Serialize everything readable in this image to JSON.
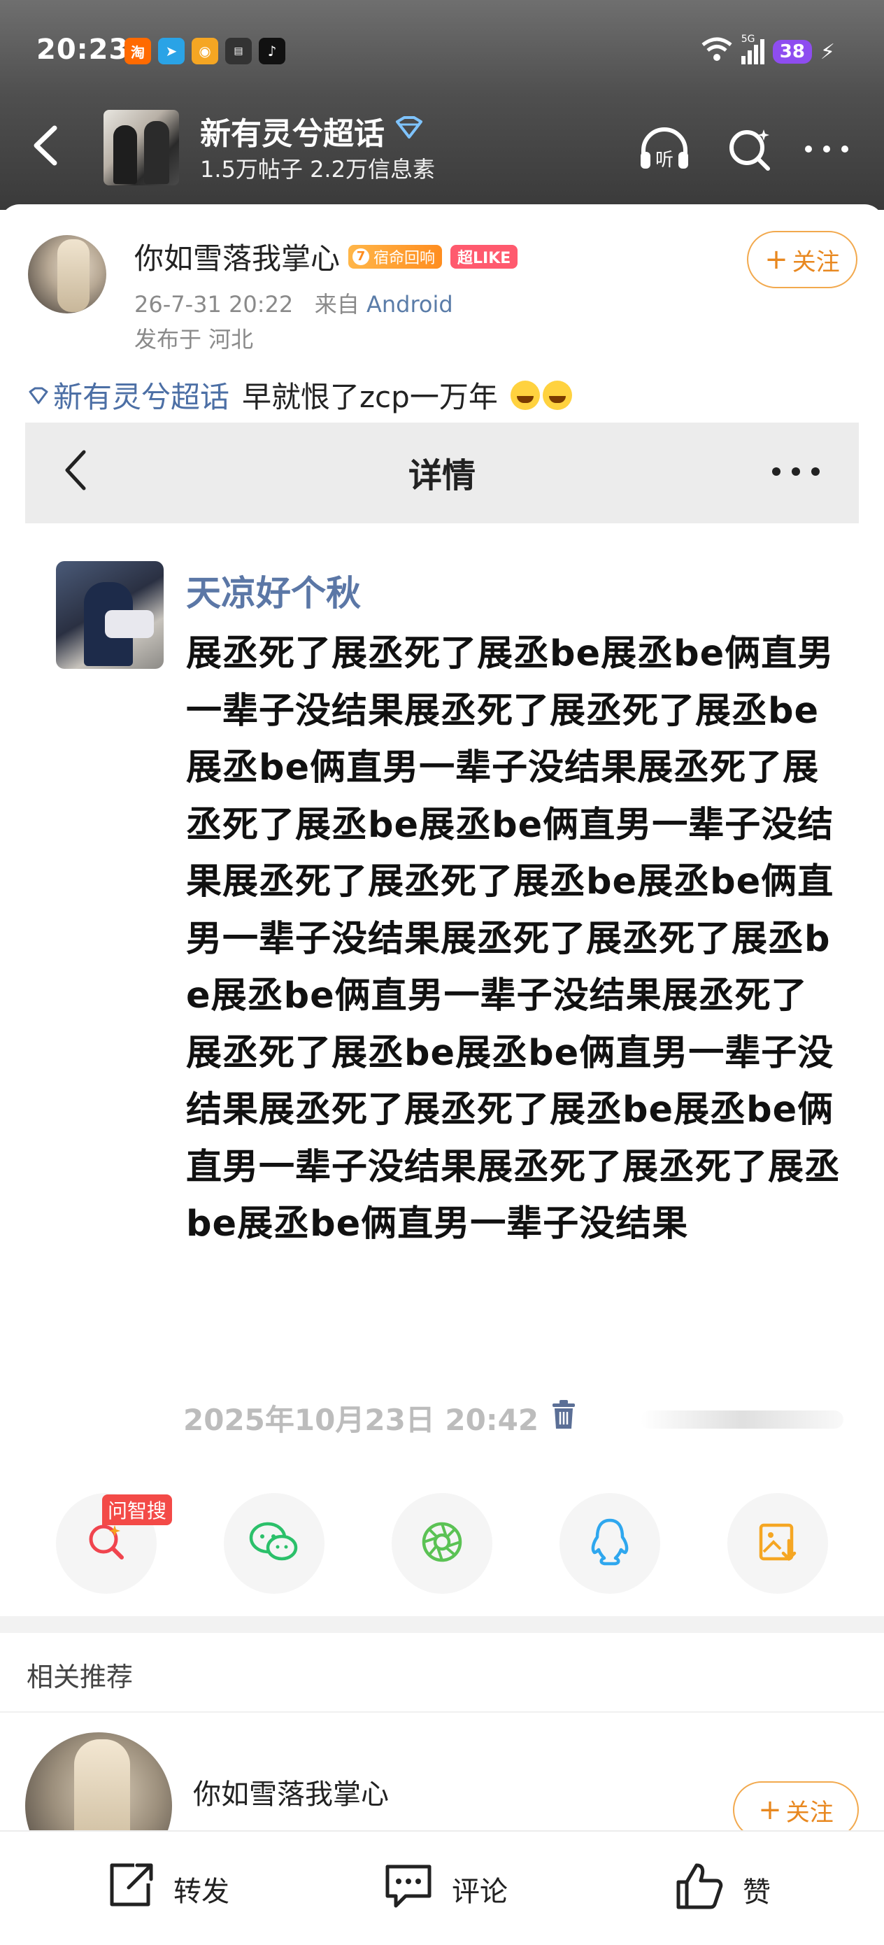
{
  "status_bar": {
    "time": "20:23",
    "network": "5G",
    "battery": "38",
    "app_icons": [
      "taobao-icon",
      "telegram-icon",
      "weibo-icon",
      "notes-icon",
      "tiktok-icon"
    ]
  },
  "header": {
    "title": "新有灵兮超话",
    "stats": "1.5万帖子 2.2万信息素",
    "icons": [
      "back-icon",
      "listen-icon",
      "search-icon",
      "more-icon"
    ]
  },
  "post": {
    "author": "你如雪落我掌心",
    "badge_level": "7",
    "badge_text": "宿命回响",
    "badge_like": "超LIKE",
    "time": "26-7-31 20:22",
    "from_label": "来自",
    "source": "Android",
    "location": "发布于 河北",
    "follow_label": "关注",
    "topic": "新有灵兮超话",
    "text": "早就恨了zcp一万年"
  },
  "embed": {
    "title": "详情",
    "username": "天凉好个秋",
    "body": "展丞死了展丞死了展丞be展丞be俩直男一辈子没结果展丞死了展丞死了展丞be展丞be俩直男一辈子没结果展丞死了展丞死了展丞be展丞be俩直男一辈子没结果展丞死了展丞死了展丞be展丞be俩直男一辈子没结果展丞死了展丞死了展丞be展丞be俩直男一辈子没结果展丞死了展丞死了展丞be展丞be俩直男一辈子没结果展丞死了展丞死了展丞be展丞be俩直男一辈子没结果展丞死了展丞死了展丞be展丞be俩直男一辈子没结果",
    "date": "2025年10月23日 20:42"
  },
  "share": {
    "tag": "问智搜",
    "items": [
      "wenzhisou-search-icon",
      "wechat-icon",
      "moments-icon",
      "qq-icon",
      "save-image-icon"
    ]
  },
  "related": {
    "heading": "相关推荐",
    "author": "你如雪落我掌心",
    "follow_label": "关注"
  },
  "bottom_bar": {
    "repost": "转发",
    "comment": "评论",
    "like": "赞"
  },
  "colors": {
    "accent_orange": "#e88820",
    "topic_blue": "#4c6fa5",
    "embed_name_blue": "#5b77a6"
  }
}
